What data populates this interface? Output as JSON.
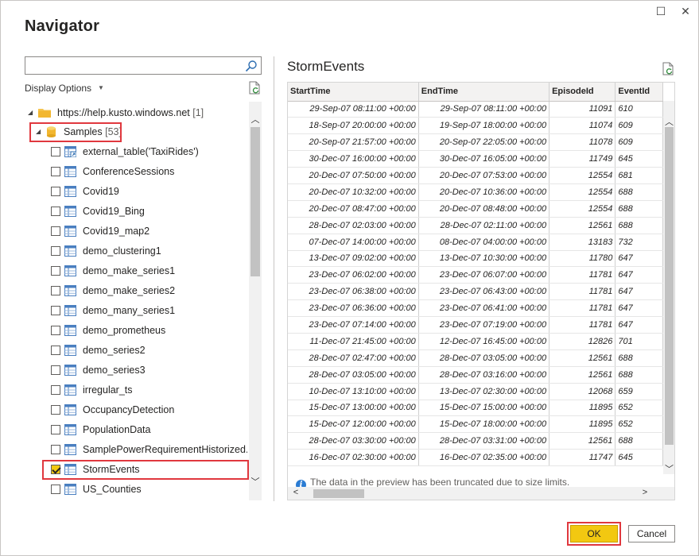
{
  "window": {
    "title": "Navigator",
    "maximize_glyph": "☐",
    "close_glyph": "✕"
  },
  "left_pane": {
    "search": {
      "value": "",
      "placeholder": ""
    },
    "display_options_label": "Display Options",
    "tree": {
      "root": {
        "label": "https://help.kusto.windows.net",
        "count": "[1]"
      },
      "database": {
        "label": "Samples",
        "count": "[53]"
      },
      "items": [
        {
          "label": "external_table('TaxiRides')",
          "checked": false,
          "icon": "external-table-icon"
        },
        {
          "label": "ConferenceSessions",
          "checked": false,
          "icon": "table-icon"
        },
        {
          "label": "Covid19",
          "checked": false,
          "icon": "table-icon"
        },
        {
          "label": "Covid19_Bing",
          "checked": false,
          "icon": "table-icon"
        },
        {
          "label": "Covid19_map2",
          "checked": false,
          "icon": "table-icon"
        },
        {
          "label": "demo_clustering1",
          "checked": false,
          "icon": "table-icon"
        },
        {
          "label": "demo_make_series1",
          "checked": false,
          "icon": "table-icon"
        },
        {
          "label": "demo_make_series2",
          "checked": false,
          "icon": "table-icon"
        },
        {
          "label": "demo_many_series1",
          "checked": false,
          "icon": "table-icon"
        },
        {
          "label": "demo_prometheus",
          "checked": false,
          "icon": "table-icon"
        },
        {
          "label": "demo_series2",
          "checked": false,
          "icon": "table-icon"
        },
        {
          "label": "demo_series3",
          "checked": false,
          "icon": "table-icon"
        },
        {
          "label": "irregular_ts",
          "checked": false,
          "icon": "table-icon"
        },
        {
          "label": "OccupancyDetection",
          "checked": false,
          "icon": "table-icon"
        },
        {
          "label": "PopulationData",
          "checked": false,
          "icon": "table-icon"
        },
        {
          "label": "SamplePowerRequirementHistorized...",
          "checked": false,
          "icon": "table-icon"
        },
        {
          "label": "StormEvents",
          "checked": true,
          "icon": "table-icon"
        },
        {
          "label": "US_Counties",
          "checked": false,
          "icon": "table-icon"
        }
      ]
    }
  },
  "preview": {
    "title": "StormEvents",
    "columns": [
      "StartTime",
      "EndTime",
      "EpisodeId",
      "EventId"
    ],
    "rows": [
      [
        "29-Sep-07 08:11:00 +00:00",
        "29-Sep-07 08:11:00 +00:00",
        "11091",
        "610"
      ],
      [
        "18-Sep-07 20:00:00 +00:00",
        "19-Sep-07 18:00:00 +00:00",
        "11074",
        "609"
      ],
      [
        "20-Sep-07 21:57:00 +00:00",
        "20-Sep-07 22:05:00 +00:00",
        "11078",
        "609"
      ],
      [
        "30-Dec-07 16:00:00 +00:00",
        "30-Dec-07 16:05:00 +00:00",
        "11749",
        "645"
      ],
      [
        "20-Dec-07 07:50:00 +00:00",
        "20-Dec-07 07:53:00 +00:00",
        "12554",
        "681"
      ],
      [
        "20-Dec-07 10:32:00 +00:00",
        "20-Dec-07 10:36:00 +00:00",
        "12554",
        "688"
      ],
      [
        "20-Dec-07 08:47:00 +00:00",
        "20-Dec-07 08:48:00 +00:00",
        "12554",
        "688"
      ],
      [
        "28-Dec-07 02:03:00 +00:00",
        "28-Dec-07 02:11:00 +00:00",
        "12561",
        "688"
      ],
      [
        "07-Dec-07 14:00:00 +00:00",
        "08-Dec-07 04:00:00 +00:00",
        "13183",
        "732"
      ],
      [
        "13-Dec-07 09:02:00 +00:00",
        "13-Dec-07 10:30:00 +00:00",
        "11780",
        "647"
      ],
      [
        "23-Dec-07 06:02:00 +00:00",
        "23-Dec-07 06:07:00 +00:00",
        "11781",
        "647"
      ],
      [
        "23-Dec-07 06:38:00 +00:00",
        "23-Dec-07 06:43:00 +00:00",
        "11781",
        "647"
      ],
      [
        "23-Dec-07 06:36:00 +00:00",
        "23-Dec-07 06:41:00 +00:00",
        "11781",
        "647"
      ],
      [
        "23-Dec-07 07:14:00 +00:00",
        "23-Dec-07 07:19:00 +00:00",
        "11781",
        "647"
      ],
      [
        "11-Dec-07 21:45:00 +00:00",
        "12-Dec-07 16:45:00 +00:00",
        "12826",
        "701"
      ],
      [
        "28-Dec-07 02:47:00 +00:00",
        "28-Dec-07 03:05:00 +00:00",
        "12561",
        "688"
      ],
      [
        "28-Dec-07 03:05:00 +00:00",
        "28-Dec-07 03:16:00 +00:00",
        "12561",
        "688"
      ],
      [
        "10-Dec-07 13:10:00 +00:00",
        "13-Dec-07 02:30:00 +00:00",
        "12068",
        "659"
      ],
      [
        "15-Dec-07 13:00:00 +00:00",
        "15-Dec-07 15:00:00 +00:00",
        "11895",
        "652"
      ],
      [
        "15-Dec-07 12:00:00 +00:00",
        "15-Dec-07 18:00:00 +00:00",
        "11895",
        "652"
      ],
      [
        "28-Dec-07 03:30:00 +00:00",
        "28-Dec-07 03:31:00 +00:00",
        "12561",
        "688"
      ],
      [
        "16-Dec-07 02:30:00 +00:00",
        "16-Dec-07 02:35:00 +00:00",
        "11747",
        "645"
      ]
    ],
    "truncated_note": "The data in the preview has been truncated due to size limits."
  },
  "footer": {
    "ok_label": "OK",
    "cancel_label": "Cancel"
  },
  "colors": {
    "accent_yellow": "#f2c811",
    "highlight_red": "#e0383e",
    "info_blue": "#2b7cd3"
  }
}
